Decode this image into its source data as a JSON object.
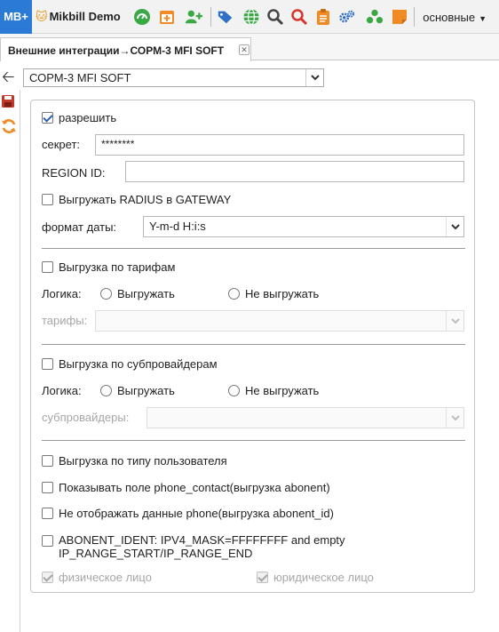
{
  "toolbar": {
    "logo": "MB+",
    "brand": "Mikbill Demo",
    "mode": "основные",
    "icons": [
      "dashboard-icon",
      "calendar-add-icon",
      "add-user-icon",
      "tags-icon",
      "globe-icon",
      "search-icon",
      "search-red-icon",
      "clipboard-icon",
      "settings-icon",
      "network-icon",
      "note-icon"
    ],
    "colors": {
      "logo_bg": "#2b7bd6",
      "accent_green": "#3aa845",
      "accent_orange": "#f08a24",
      "accent_red": "#d9342b",
      "accent_blue": "#2f6fc7"
    }
  },
  "tabs": [
    {
      "label": "Внешние интеграции→СОРМ-3 MFI SOFT",
      "active": true
    }
  ],
  "module_selector": {
    "value": "СОРМ-3 MFI SOFT"
  },
  "form": {
    "enable": {
      "label": "разрешить",
      "checked": true
    },
    "secret": {
      "label": "секрет:",
      "value": "********"
    },
    "region_id": {
      "label": "REGION ID:",
      "value": ""
    },
    "radius_gateway": {
      "label": "Выгружать RADIUS в GATEWAY",
      "checked": false
    },
    "date_format": {
      "label": "формат даты:",
      "value": "Y-m-d H:i:s"
    },
    "tariffs_section": {
      "toggle": {
        "label": "Выгрузка по тарифам",
        "checked": false
      },
      "logic_label": "Логика:",
      "option_export": "Выгружать",
      "option_no_export": "Не выгружать",
      "select_label": "тарифы:"
    },
    "subproviders_section": {
      "toggle": {
        "label": "Выгрузка по субпровайдерам",
        "checked": false
      },
      "logic_label": "Логика:",
      "option_export": "Выгружать",
      "option_no_export": "Не выгружать",
      "select_label": "субпровайдеры:"
    },
    "user_type": {
      "label": "Выгрузка по типу пользователя",
      "checked": false
    },
    "phone_contact": {
      "label": "Показывать поле phone_contact(выгрузка abonent)",
      "checked": false
    },
    "hide_phone": {
      "label": "Не отображать данные phone(выгрузка abonent_id)",
      "checked": false
    },
    "abonent_ident": {
      "label_line1": "ABONENT_IDENT: IPV4_MASK=FFFFFFFF and empty",
      "label_line2": "IP_RANGE_START/IP_RANGE_END",
      "checked": false
    },
    "individual": {
      "label": "физическое лицо",
      "checked": true,
      "disabled": true
    },
    "legal": {
      "label": "юридическое лицо",
      "checked": true,
      "disabled": true
    }
  }
}
